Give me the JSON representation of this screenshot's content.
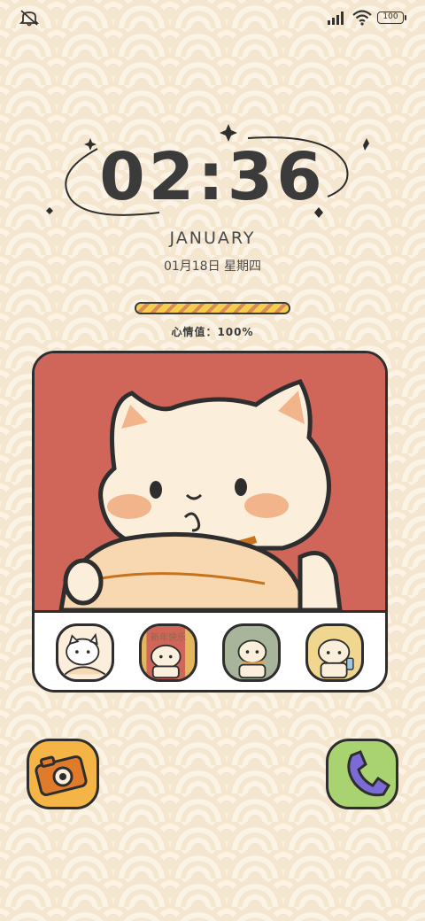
{
  "status_bar": {
    "battery_level": "100",
    "icons": [
      "mute-icon",
      "signal-icon",
      "wifi-icon",
      "battery-icon"
    ]
  },
  "lockscreen": {
    "time": "02:36",
    "month": "JANUARY",
    "date": "01月18日 星期四",
    "mood_label": "心情值：100%",
    "mood_level": 1.0
  },
  "widget": {
    "thumbs": [
      {
        "name": "cat-thumb-1",
        "caption": ""
      },
      {
        "name": "cat-thumb-2",
        "caption": "新年快乐"
      },
      {
        "name": "cat-thumb-3",
        "caption": ""
      },
      {
        "name": "cat-thumb-4",
        "caption": ""
      }
    ]
  },
  "shortcuts": {
    "left": "camera-icon",
    "right": "phone-icon"
  },
  "colors": {
    "background": "#f5e6cf",
    "pattern": "#fbf3e6",
    "widget_red": "#d0665a",
    "camera_orange": "#f5b546",
    "phone_green": "#a8d370",
    "phone_purple": "#7a6bd6",
    "outline": "#2e2e2e"
  }
}
